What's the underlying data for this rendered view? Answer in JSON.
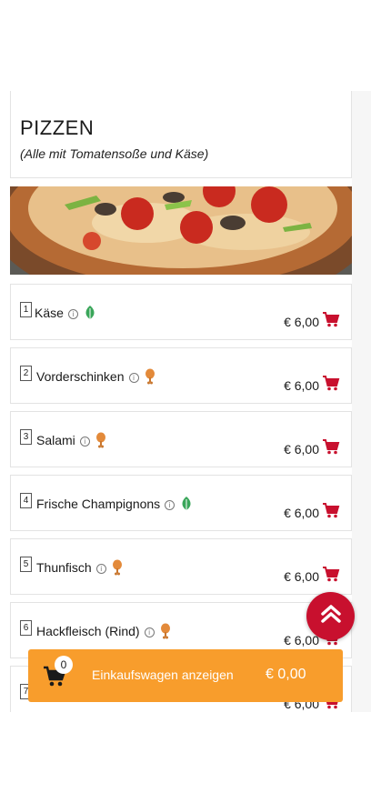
{
  "section": {
    "title": "PIZZEN",
    "subtitle": "(Alle mit Tomatensoße und Käse)"
  },
  "colors": {
    "accent_red": "#c8102e",
    "cart_orange": "#f89d2c",
    "veggie_green": "#3aa65a",
    "meat_orange": "#e38a3a"
  },
  "items": [
    {
      "number": "1",
      "name": "Käse",
      "price": "€ 6,00",
      "tag": "leaf-icon"
    },
    {
      "number": "2",
      "name": "Vorderschinken",
      "price": "€ 6,00",
      "tag": "drumstick-icon"
    },
    {
      "number": "3",
      "name": "Salami",
      "price": "€ 6,00",
      "tag": "drumstick-icon"
    },
    {
      "number": "4",
      "name": "Frische Champignons",
      "price": "€ 6,00",
      "tag": "leaf-icon"
    },
    {
      "number": "5",
      "name": "Thunfisch",
      "price": "€ 6,00",
      "tag": "drumstick-icon"
    },
    {
      "number": "6",
      "name": "Hackfleisch (Rind)",
      "price": "€ 6,00",
      "tag": "drumstick-icon"
    },
    {
      "number": "7",
      "name": "",
      "price": "€ 6,00",
      "tag": ""
    }
  ],
  "cart": {
    "count": "0",
    "label": "Einkaufswagen anzeigen",
    "total": "€ 0,00"
  }
}
